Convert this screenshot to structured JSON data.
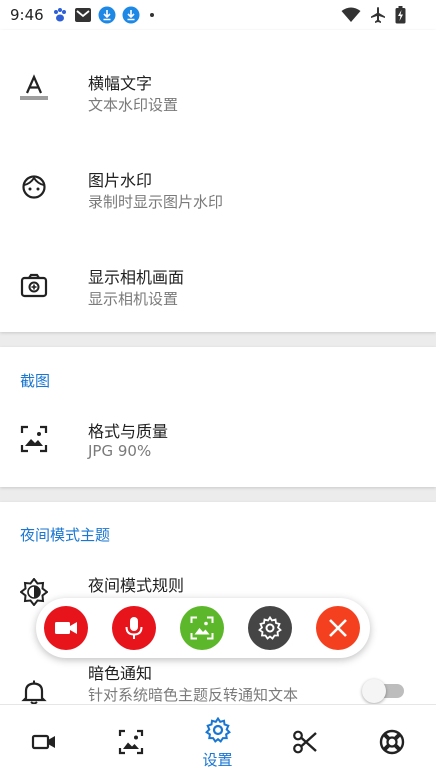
{
  "status_bar": {
    "time": "9:46"
  },
  "card1": {
    "items": [
      {
        "title": "横幅文字",
        "subtitle": "文本水印设置",
        "icon": "text-format-icon"
      },
      {
        "title": "图片水印",
        "subtitle": "录制时显示图片水印",
        "icon": "face-icon"
      },
      {
        "title": "显示相机画面",
        "subtitle": "显示相机设置",
        "icon": "camera-icon"
      }
    ]
  },
  "screenshot_section": {
    "header": "截图",
    "items": [
      {
        "title": "格式与质量",
        "subtitle": "JPG 90%",
        "icon": "image-icon"
      }
    ]
  },
  "night_section": {
    "header": "夜间模式主题",
    "items": [
      {
        "title": "夜间模式规则",
        "subtitle": "",
        "icon": "brightness-icon"
      },
      {
        "title": "暗色通知",
        "subtitle": "针对系统暗色主题反转通知文本",
        "icon": "bell-icon",
        "toggle": false
      }
    ]
  },
  "floating_toolbar": {
    "buttons": [
      {
        "name": "record-video",
        "color": "#e8141c"
      },
      {
        "name": "microphone",
        "color": "#e8141c"
      },
      {
        "name": "screenshot",
        "color": "#5cb82a"
      },
      {
        "name": "settings",
        "color": "#454545"
      },
      {
        "name": "close",
        "color": "#f4401e"
      }
    ]
  },
  "bottom_nav": {
    "items": [
      {
        "name": "videos",
        "label": ""
      },
      {
        "name": "screenshots",
        "label": ""
      },
      {
        "name": "settings",
        "label": "设置",
        "active": true
      },
      {
        "name": "tools",
        "label": ""
      },
      {
        "name": "help",
        "label": ""
      }
    ]
  },
  "colors": {
    "accent": "#1976d2",
    "red": "#e8141c",
    "green": "#5cb82a",
    "dark": "#454545",
    "orange_red": "#f4401e"
  }
}
